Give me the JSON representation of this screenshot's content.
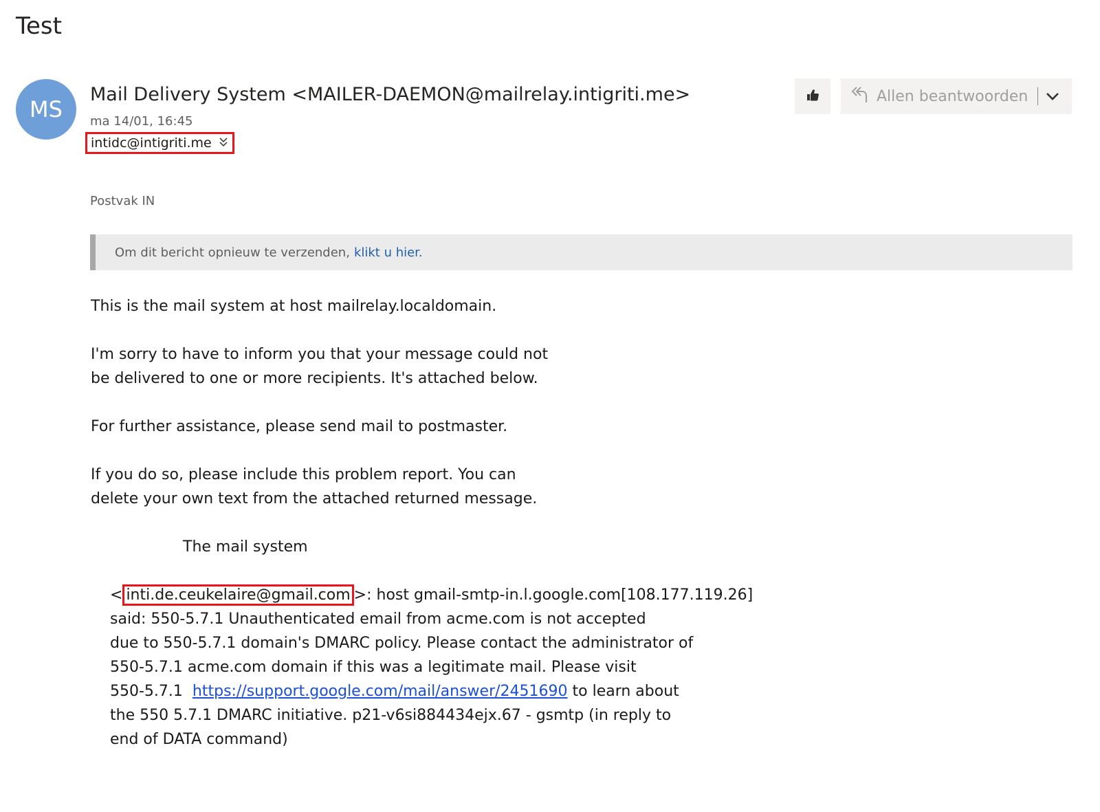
{
  "subject": "Test",
  "sender": {
    "initials": "MS",
    "display": "Mail Delivery System <MAILER-DAEMON@mailrelay.intigriti.me>",
    "date": "ma 14/01, 16:45",
    "recipient": "intidc@intigriti.me"
  },
  "actions": {
    "reply_all_label": "Allen beantwoorden"
  },
  "folder": "Postvak IN",
  "banner": {
    "text": "Om dit bericht opnieuw te verzenden,",
    "link": "klikt u hier."
  },
  "body": {
    "p1": "This is the mail system at host mailrelay.localdomain.",
    "p2_l1": "I'm sorry to have to inform you that your message could not",
    "p2_l2": "be delivered to one or more recipients. It's attached below.",
    "p3": "For further assistance, please send mail to postmaster.",
    "p4_l1": "If you do so, please include this problem report. You can",
    "p4_l2": "delete your own text from the attached returned message.",
    "signature": "The mail system",
    "err_open": "<",
    "err_addr": "inti.de.ceukelaire@gmail.com",
    "err_rest": ">: host gmail-smtp-in.l.google.com[108.177.119.26]",
    "err_l2": "said: 550-5.7.1 Unauthenticated email from acme.com is not accepted",
    "err_l3": "due to 550-5.7.1 domain's DMARC policy. Please contact the administrator of",
    "err_l4": "550-5.7.1 acme.com domain if this was a legitimate mail. Please visit",
    "err_l5_pre": "550-5.7.1  ",
    "err_l5_link": "https://support.google.com/mail/answer/2451690",
    "err_l5_post": " to learn about",
    "err_l6": "the 550 5.7.1 DMARC initiative. p21-v6si884434ejx.67 - gsmtp (in reply to",
    "err_l7": "end of DATA command)"
  },
  "colors": {
    "avatar": "#6f9fd8",
    "highlight_box": "#e8151b",
    "banner_link": "#1f5fae",
    "body_link": "#1a4fd6"
  },
  "icons": [
    "thumbs-up-icon",
    "reply-all-icon",
    "chevron-down-icon",
    "expand-recipients-icon"
  ]
}
